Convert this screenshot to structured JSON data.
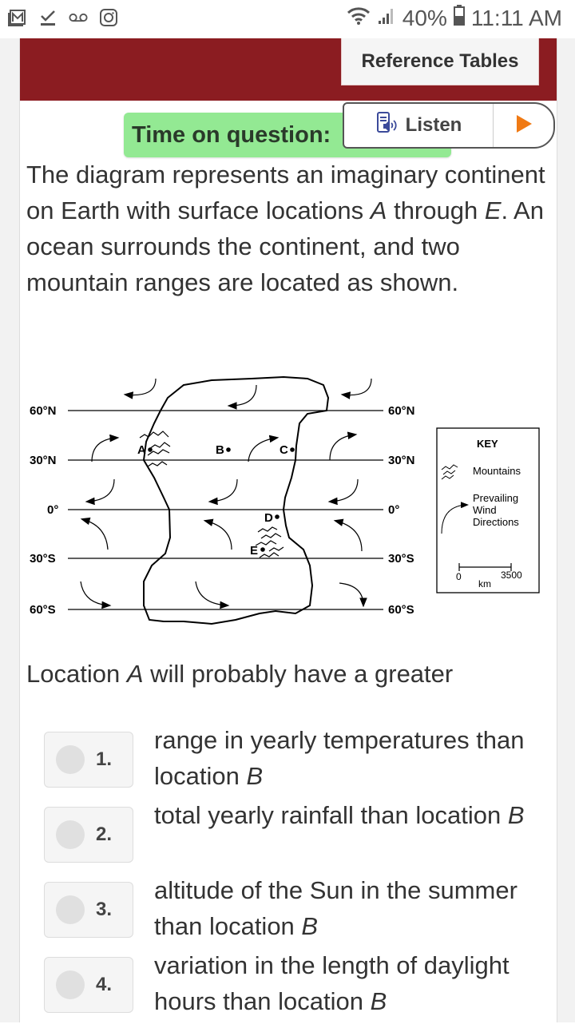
{
  "status_bar": {
    "left_icons": [
      "gmail-icon",
      "checkmark-task-icon",
      "voicemail-icon",
      "instagram-icon"
    ],
    "wifi_icon": "wifi-icon",
    "signal_icon": "signal-icon",
    "battery_percent": "40%",
    "battery_icon": "battery-icon",
    "time": "11:11 AM"
  },
  "header": {
    "reference_tables_label": "Reference Tables",
    "brand_color": "#8b1c21"
  },
  "timer": {
    "label": "Time on question:",
    "color": "#93e993"
  },
  "listen": {
    "label": "Listen",
    "speaker_icon": "text-to-speech-icon",
    "play_icon": "play-icon",
    "play_color": "#f07a14"
  },
  "question": {
    "prompt_parts": [
      "The diagram represents an imaginary continent on Earth with surface locations ",
      "A",
      " through ",
      "E",
      ".  An ocean surrounds the continent, and two mountain ranges are located as shown."
    ],
    "stem_parts": [
      "Location ",
      "A",
      " will probably have a greater"
    ]
  },
  "diagram": {
    "latitude_labels_left": [
      "60°N",
      "30°N",
      "0°",
      "30°S",
      "60°S"
    ],
    "latitude_labels_right": [
      "60°N",
      "30°N",
      "0°",
      "30°S",
      "60°S"
    ],
    "locations": [
      "A",
      "B",
      "C",
      "D",
      "E"
    ],
    "key": {
      "title": "KEY",
      "mountains_label": "Mountains",
      "wind_label_lines": [
        "Prevailing",
        "Wind",
        "Directions"
      ],
      "scale_start": "0",
      "scale_end": "3500",
      "scale_unit": "km"
    }
  },
  "options": [
    {
      "number": "1.",
      "text_parts": [
        "range in yearly temperatures than location ",
        "B"
      ]
    },
    {
      "number": "2.",
      "text_parts": [
        "total yearly rainfall than location ",
        "B"
      ]
    },
    {
      "number": "3.",
      "text_parts": [
        "altitude of the Sun in the summer than location ",
        "B"
      ]
    },
    {
      "number": "4.",
      "text_parts": [
        "variation in the length of daylight hours than location ",
        "B"
      ]
    }
  ]
}
